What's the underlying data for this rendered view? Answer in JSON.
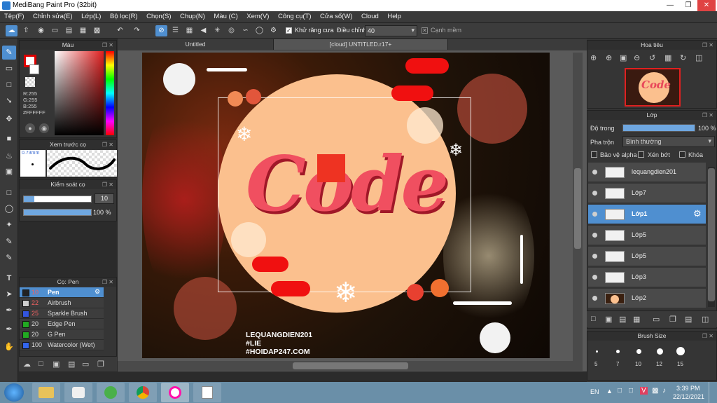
{
  "window": {
    "title": "MediBang Paint Pro (32bit)"
  },
  "menu": [
    "Tệp(F)",
    "Chỉnh sửa(E)",
    "Lớp(L)",
    "Bộ lọc(R)",
    "Chọn(S)",
    "Chụp(N)",
    "Màu (C)",
    "Xem(V)",
    "Công cụ(T)",
    "Cửa sổ(W)",
    "Cloud",
    "Help"
  ],
  "toolbar": {
    "antialias_label": "Khử răng cưa",
    "adjust_label": "Điều chỉnh",
    "adjust_value": "40",
    "smooth_label": "Cạnh mềm"
  },
  "color_panel": {
    "title": "Màu",
    "r": "R:255",
    "g": "G:255",
    "b": "B:255",
    "hex": "#FFFFFF"
  },
  "preview_panel": {
    "title": "Xem trước cọ",
    "size": "0.73mm"
  },
  "brush_control": {
    "title": "Kiểm soát cọ",
    "size": "10",
    "opacity": "100 %"
  },
  "brush_list": {
    "title": "Cọ: Pen",
    "items": [
      {
        "size": "10",
        "name": "Pen",
        "color": "#ffffff"
      },
      {
        "size": "22",
        "name": "Airbrush",
        "color": "#cfcfcf"
      },
      {
        "size": "25",
        "name": "Sparkle Brush",
        "color": "#3355dd"
      },
      {
        "size": "20",
        "name": "Edge Pen",
        "color": "#22aa22"
      },
      {
        "size": "20",
        "name": "G Pen",
        "color": "#22aa22"
      },
      {
        "size": "100",
        "name": "Watercolor (Wet)",
        "color": "#3366ee"
      }
    ]
  },
  "canvas_tabs": [
    "Untitled",
    "[cloud] UNTITLED.r17+"
  ],
  "artwork": {
    "main_text": "Code",
    "watermark": [
      "LEQUANGDIEN201",
      "#LIE",
      "#HOIDAP247.COM"
    ]
  },
  "navigator": {
    "title": "Hoa tiêu",
    "thumb_text": "Code"
  },
  "layer_panel": {
    "title": "Lớp",
    "opacity_label": "Độ trong",
    "opacity_value": "100 %",
    "blend_label": "Pha trộn",
    "blend_value": "Bình thường",
    "protect_alpha": "Bảo vệ alpha",
    "clip": "Xén bớt",
    "lock": "Khóa",
    "layers": [
      {
        "name": "lequangdien201",
        "selected": false
      },
      {
        "name": "Lớp7",
        "selected": false
      },
      {
        "name": "Lớp1",
        "selected": true
      },
      {
        "name": "Lớp5",
        "selected": false
      },
      {
        "name": "Lớp5",
        "selected": false
      },
      {
        "name": "Lớp3",
        "selected": false
      },
      {
        "name": "Lớp2",
        "selected": false
      }
    ]
  },
  "brush_size_panel": {
    "title": "Brush Size",
    "sizes": [
      "5",
      "7",
      "10",
      "12",
      "15"
    ]
  },
  "taskbar": {
    "lang": "EN",
    "time": "3:39 PM",
    "date": "22/12/2021"
  }
}
